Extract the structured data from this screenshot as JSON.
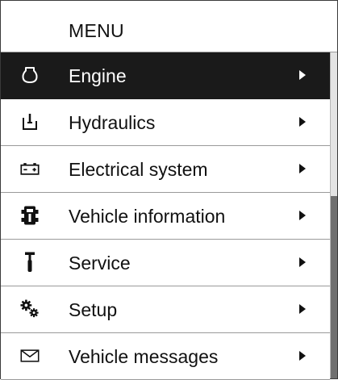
{
  "menu": {
    "title": "MENU",
    "items": [
      {
        "label": "Engine",
        "icon": "engine-icon",
        "selected": true
      },
      {
        "label": "Hydraulics",
        "icon": "hydraulics-icon",
        "selected": false
      },
      {
        "label": "Electrical system",
        "icon": "battery-icon",
        "selected": false
      },
      {
        "label": "Vehicle information",
        "icon": "vehicle-info-icon",
        "selected": false
      },
      {
        "label": "Service",
        "icon": "service-tool-icon",
        "selected": false
      },
      {
        "label": "Setup",
        "icon": "gears-icon",
        "selected": false
      },
      {
        "label": "Vehicle messages",
        "icon": "envelope-icon",
        "selected": false
      }
    ]
  },
  "colors": {
    "selected_background": "#1a1a1a",
    "selected_text": "#ffffff",
    "text": "#111111",
    "divider": "#9a9a9a"
  }
}
